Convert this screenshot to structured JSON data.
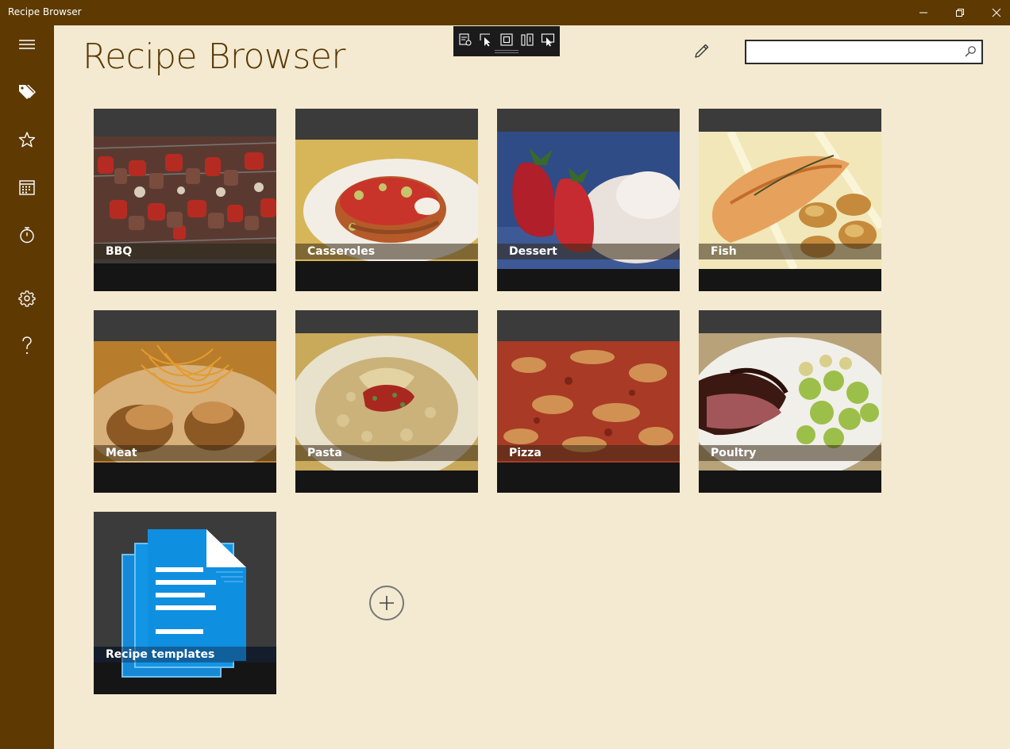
{
  "window": {
    "title": "Recipe Browser",
    "titlebar_color": "#5e3a02"
  },
  "sidebar": {
    "items": [
      {
        "name": "menu",
        "icon": "hamburger-icon"
      },
      {
        "name": "tags",
        "icon": "tags-icon"
      },
      {
        "name": "favorites",
        "icon": "star-icon"
      },
      {
        "name": "calendar",
        "icon": "calendar-icon"
      },
      {
        "name": "timer",
        "icon": "stopwatch-icon"
      },
      {
        "name": "settings",
        "icon": "gear-icon"
      },
      {
        "name": "help",
        "icon": "help-icon"
      }
    ]
  },
  "header": {
    "title": "Recipe Browser",
    "edit_icon": "pencil-icon",
    "search": {
      "value": "",
      "placeholder": "",
      "icon": "search-icon"
    }
  },
  "debug_toolbar": {
    "buttons": [
      "live-visual-tree-icon",
      "select-element-icon",
      "display-layout-adorners-icon",
      "track-focus-icon",
      "preview-selection-icon"
    ]
  },
  "categories": [
    {
      "label": "BBQ",
      "icon": "bbq-photo"
    },
    {
      "label": "Casseroles",
      "icon": "casserole-photo"
    },
    {
      "label": "Dessert",
      "icon": "dessert-photo"
    },
    {
      "label": "Fish",
      "icon": "fish-photo"
    },
    {
      "label": "Meat",
      "icon": "meat-photo"
    },
    {
      "label": "Pasta",
      "icon": "pasta-photo"
    },
    {
      "label": "Pizza",
      "icon": "pizza-photo"
    },
    {
      "label": "Poultry",
      "icon": "poultry-photo"
    },
    {
      "label": "Recipe templates",
      "icon": "documents-icon"
    }
  ],
  "add_button": {
    "icon": "plus-icon"
  },
  "colors": {
    "accent": "#5e3a02",
    "background": "#f3ead1",
    "title_text": "#5a3904",
    "template_blue": "#1395e6"
  }
}
